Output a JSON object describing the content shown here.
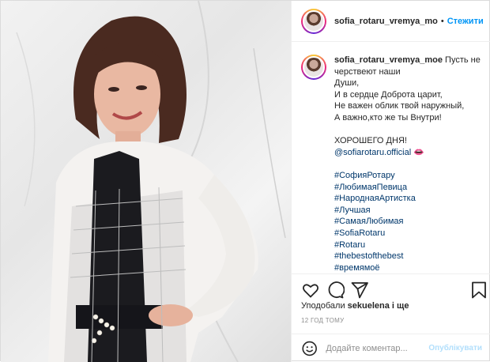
{
  "header": {
    "username": "sofia_rotaru_vremya_mo",
    "separator": "•",
    "follow_label": "Стежити"
  },
  "caption": {
    "username": "sofia_rotaru_vremya_moe",
    "first_line": "Пусть не",
    "lines": [
      "черствеют наши",
      "Души,",
      "И в сердце Доброта царит,",
      "Не важен облик твой наружный,",
      "А важно,кто же ты Внутри!"
    ],
    "greeting": "ХОРОШЕГО ДНЯ!",
    "mention": "@sofiarotaru.official",
    "mention_emoji": "👄",
    "hashtags": [
      "#СофияРотару",
      "#ЛюбимаяПевица",
      "#НароднаяАртистка",
      "#Лучшая",
      "#СамаяЛюбимая",
      "#SofiaRotaru",
      "#Rotaru",
      "#thebestofthebest",
      "#времямоё"
    ]
  },
  "likes": {
    "prefix": "Уподобали",
    "user": "sekuelena",
    "suffix": "і ще"
  },
  "timestamp": "12 ГОД ТОМУ",
  "comment": {
    "placeholder": "Додайте коментар...",
    "publish_label": "Опублікувати"
  },
  "colors": {
    "accent": "#0095f6",
    "link": "#00376b",
    "publish_disabled": "#b2dffc"
  },
  "icons": [
    "heart-icon",
    "comment-icon",
    "share-icon",
    "bookmark-icon",
    "emoji-icon"
  ]
}
